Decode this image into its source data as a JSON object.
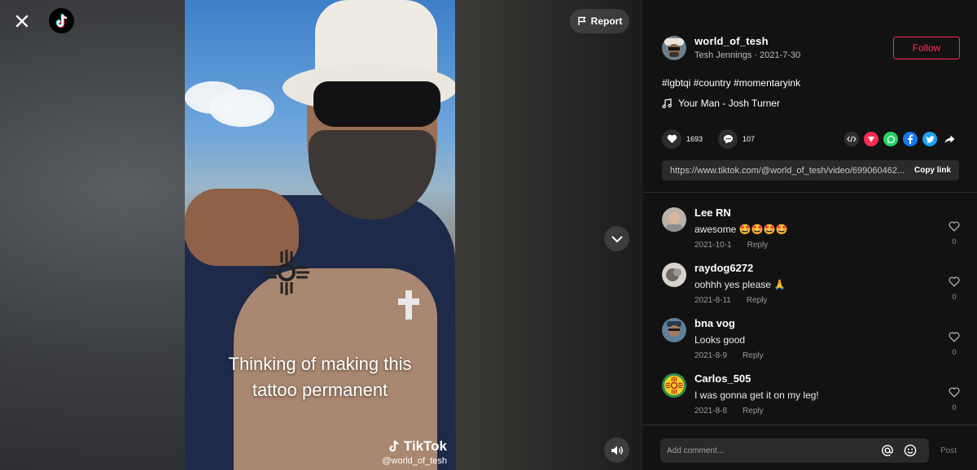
{
  "player": {
    "report_label": "Report",
    "video_caption_line1": "Thinking of making this",
    "video_caption_line2": "tattoo permanent",
    "watermark_brand": "TikTok",
    "watermark_user": "@world_of_tesh"
  },
  "author": {
    "username": "world_of_tesh",
    "display_name": "Tesh Jennings",
    "date": "2021-7-30",
    "follow_label": "Follow"
  },
  "post": {
    "hashtags": "#lgbtqi #country #momentaryink",
    "music": "Your Man - Josh Turner",
    "likes": "1693",
    "comments": "107",
    "link": "https://www.tiktok.com/@world_of_tesh/video/699060462...",
    "copy_label": "Copy link"
  },
  "comments": [
    {
      "name": "Lee RN",
      "text": "awesome 🤩🤩🤩🤩",
      "date": "2021-10-1",
      "reply": "Reply",
      "likes": "0"
    },
    {
      "name": "raydog6272",
      "text": "oohhh yes please 🙏",
      "date": "2021-8-11",
      "reply": "Reply",
      "likes": "0"
    },
    {
      "name": "bna vog",
      "text": "Looks good",
      "date": "2021-8-9",
      "reply": "Reply",
      "likes": "0"
    },
    {
      "name": "Carlos_505",
      "text": "I was gonna get it on my leg!",
      "date": "2021-8-8",
      "reply": "Reply",
      "likes": "0"
    }
  ],
  "composer": {
    "placeholder": "Add comment...",
    "post_label": "Post"
  },
  "colors": {
    "accent": "#fe2c55",
    "panel_bg": "#121212"
  },
  "icons": [
    "close-icon",
    "tiktok-logo",
    "flag-icon",
    "chevron-down-icon",
    "volume-icon",
    "music-note-icon",
    "heart-icon",
    "comment-icon",
    "embed-icon",
    "send-icon",
    "whatsapp-icon",
    "facebook-icon",
    "twitter-icon",
    "share-arrow-icon",
    "at-icon",
    "emoji-icon"
  ]
}
